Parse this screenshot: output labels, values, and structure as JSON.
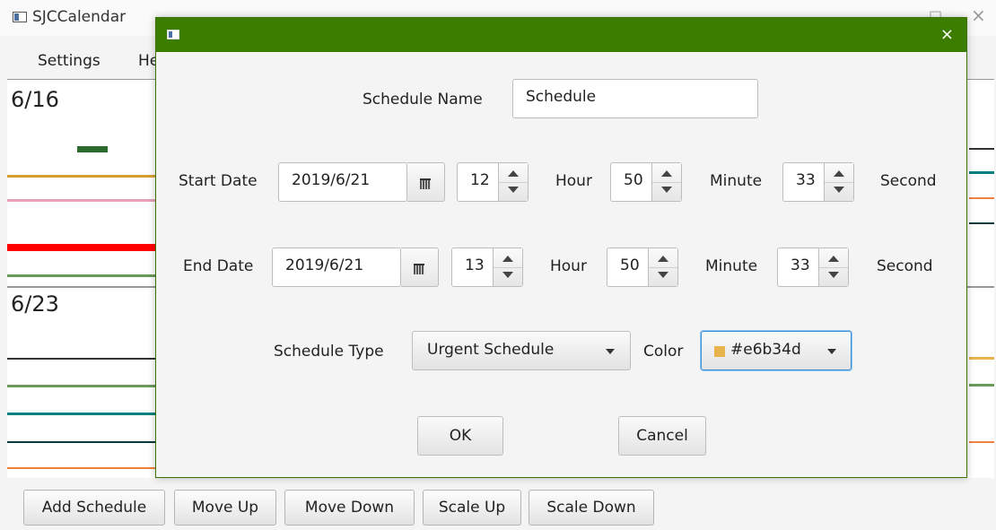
{
  "main_window": {
    "title": "SJCCalendar",
    "menu": [
      "Settings",
      "He"
    ],
    "minimize_glyph": "□",
    "close_glyph": "×"
  },
  "calendar": {
    "weeks": [
      {
        "date": "6/16"
      },
      {
        "date": "6/23"
      }
    ],
    "line_colors": [
      "#2d6a2d",
      "#d4a030",
      "#e8a0b8",
      "#ff0000",
      "#6a9a5a",
      "#333333",
      "#008080",
      "#0d3a3a",
      "#f08040",
      "#e6b34d"
    ]
  },
  "toolbar": {
    "add_schedule": "Add Schedule",
    "move_up": "Move Up",
    "move_down": "Move Down",
    "scale_up": "Scale Up",
    "scale_down": "Scale Down"
  },
  "dialog": {
    "close_glyph": "×",
    "schedule_name_label": "Schedule Name",
    "schedule_name_value": "Schedule",
    "start": {
      "label": "Start Date",
      "date": "2019/6/21",
      "hour": "12",
      "minute": "50",
      "second": "33"
    },
    "end": {
      "label": "End Date",
      "date": "2019/6/21",
      "hour": "13",
      "minute": "50",
      "second": "33"
    },
    "units": {
      "hour": "Hour",
      "minute": "Minute",
      "second": "Second"
    },
    "schedule_type_label": "Schedule Type",
    "schedule_type_value": "Urgent Schedule",
    "color_label": "Color",
    "color_value": "#e6b34d",
    "ok": "OK",
    "cancel": "Cancel",
    "accent": "#3c7d00"
  }
}
